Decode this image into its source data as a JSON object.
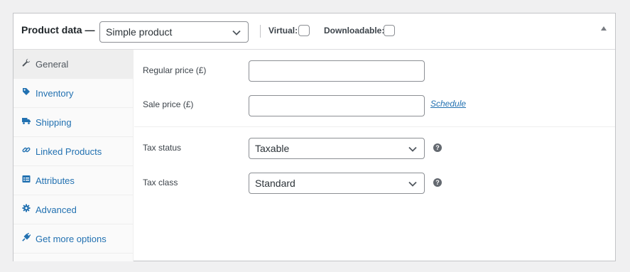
{
  "header": {
    "title": "Product data",
    "dash": "—",
    "product_type": {
      "selected": "Simple product"
    },
    "virtual_label": "Virtual:",
    "downloadable_label": "Downloadable:"
  },
  "sidebar": {
    "items": [
      {
        "label": "General",
        "icon": "wrench-icon",
        "active": true
      },
      {
        "label": "Inventory",
        "icon": "tag-icon"
      },
      {
        "label": "Shipping",
        "icon": "truck-icon"
      },
      {
        "label": "Linked Products",
        "icon": "link-icon"
      },
      {
        "label": "Attributes",
        "icon": "list-icon"
      },
      {
        "label": "Advanced",
        "icon": "gear-icon"
      },
      {
        "label": "Get more options",
        "icon": "plugin-icon"
      }
    ]
  },
  "general": {
    "regular_price_label": "Regular price (£)",
    "regular_price_value": "",
    "sale_price_label": "Sale price (£)",
    "sale_price_value": "",
    "schedule_link": "Schedule",
    "tax_status_label": "Tax status",
    "tax_status_selected": "Taxable",
    "tax_class_label": "Tax class",
    "tax_class_selected": "Standard",
    "help_glyph": "?"
  },
  "colors": {
    "link": "#2271b1",
    "active_tab_bg": "#eeeeee",
    "page_bg": "#f0f0f1"
  }
}
